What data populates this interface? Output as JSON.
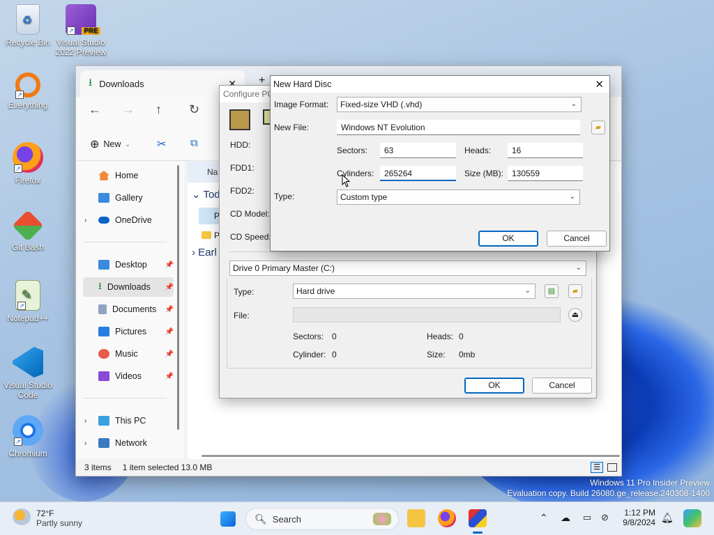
{
  "desktop": {
    "icons": [
      {
        "label": "Recycle Bin",
        "icon": "recycle-bin-icon"
      },
      {
        "label": "Visual Studio 2022 Preview",
        "icon": "visual-studio-preview-icon",
        "badge": "PRE"
      },
      {
        "label": "Everything",
        "icon": "everything-search-icon"
      },
      {
        "label": "Firefox",
        "icon": "firefox-icon"
      },
      {
        "label": "Git Bash",
        "icon": "git-bash-icon"
      },
      {
        "label": "Notepad++",
        "icon": "notepadpp-icon"
      },
      {
        "label": "Visual Studio Code",
        "icon": "vscode-icon"
      },
      {
        "label": "Chromium",
        "icon": "chromium-icon"
      }
    ],
    "watermark": {
      "line1": "Windows 11 Pro Insider Preview",
      "line2": "Evaluation copy. Build 26080.ge_release.240308-1400"
    }
  },
  "explorer": {
    "tab_title": "Downloads",
    "new_label": "New",
    "column_header": "Na",
    "groups": {
      "today": "Tod",
      "earlier": "Earl"
    },
    "files": [
      "P",
      "P"
    ],
    "nav": {
      "home": "Home",
      "gallery": "Gallery",
      "onedrive": "OneDrive",
      "desktop": "Desktop",
      "downloads": "Downloads",
      "documents": "Documents",
      "pictures": "Pictures",
      "music": "Music",
      "videos": "Videos",
      "thispc": "This PC",
      "network": "Network"
    },
    "status": {
      "items": "3 items",
      "selected": "1 item selected  13.0 MB"
    }
  },
  "configure_pc": {
    "title": "Configure PC",
    "labels": {
      "hdd": "HDD:",
      "fdd1": "FDD1:",
      "fdd2": "FDD2:",
      "cd_model": "CD Model:",
      "cd_speed": "CD Speed:"
    },
    "drive_select": "Drive 0 Primary Master (C:)",
    "type_label": "Type:",
    "type_value": "Hard drive",
    "file_label": "File:",
    "file_value": "",
    "sectors_label": "Sectors:",
    "sectors_value": "0",
    "heads_label": "Heads:",
    "heads_value": "0",
    "cylinder_label": "Cylinder:",
    "cylinder_value": "0",
    "size_label": "Size:",
    "size_value": "0mb",
    "ok": "OK",
    "cancel": "Cancel"
  },
  "new_hard_disc": {
    "title": "New Hard Disc",
    "image_format_label": "Image Format:",
    "image_format_value": "Fixed-size VHD (.vhd)",
    "new_file_label": "New File:",
    "new_file_value": "Windows NT Evolution",
    "sectors_label": "Sectors:",
    "sectors_value": "63",
    "heads_label": "Heads:",
    "heads_value": "16",
    "cylinders_label": "Cylinders:",
    "cylinders_value": "265264",
    "size_label": "Size (MB):",
    "size_value": "130559",
    "type_label": "Type:",
    "type_value": "Custom type",
    "ok": "OK",
    "cancel": "Cancel"
  },
  "taskbar": {
    "weather_temp": "72°F",
    "weather_desc": "Partly sunny",
    "search_placeholder": "Search",
    "time": "1:12 PM",
    "date": "9/8/2024"
  }
}
